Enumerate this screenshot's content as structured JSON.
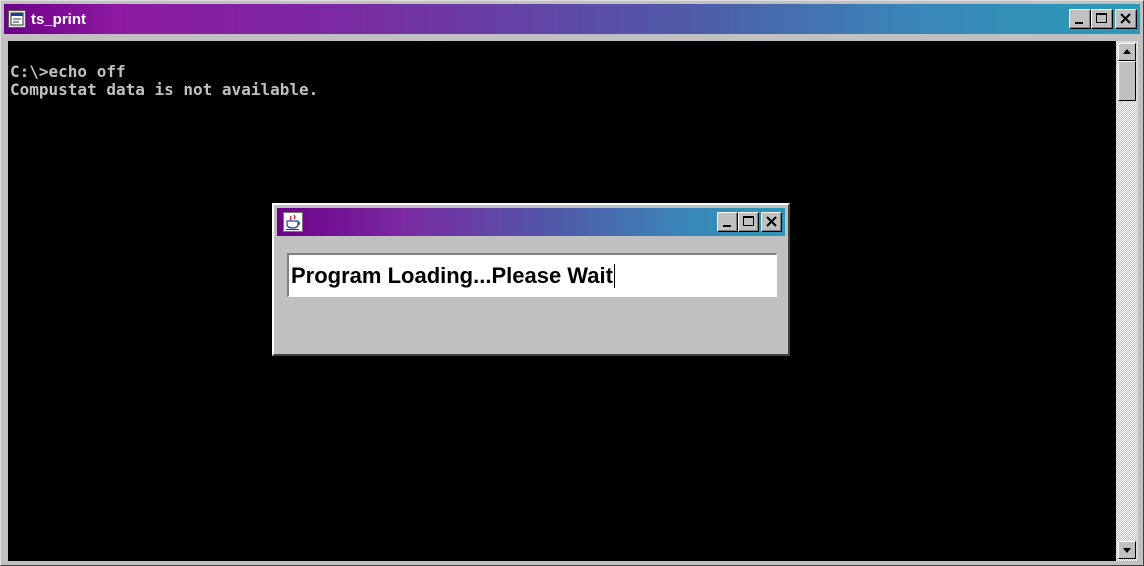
{
  "window": {
    "title": "ts_print",
    "icon": "console-window-icon"
  },
  "controls": {
    "minimize": "minimize-icon",
    "maximize": "maximize-icon",
    "close": "close-icon"
  },
  "console": {
    "lines": [
      "C:\\>echo off",
      "Compustat data is not available."
    ]
  },
  "dialog": {
    "icon": "java-cup-icon",
    "message": "Program Loading...Please Wait"
  },
  "colors": {
    "titlebar_start": "#6e0088",
    "titlebar_end": "#2a9ab8",
    "console_bg": "#000000",
    "console_text": "#c0c0c0",
    "chrome": "#c0c0c0"
  }
}
